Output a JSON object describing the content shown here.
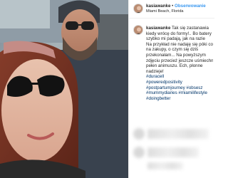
{
  "post": {
    "username": "kasiawanke",
    "separator": "•",
    "follow_label": "Obserwowanie",
    "location": "Miami Beach, Florida"
  },
  "caption": {
    "username": "kasiawanke",
    "lines": [
      " Tak się zastanawia",
      "kiedy wrócę do formy!.. Bo batery",
      "szybko mi padają, jak na razie",
      "Na przykład nie nadaję się póki co",
      "na zakupy, o czym się dziś",
      "przekonałam... Na powyższym",
      "zdjęciu przecież jeszcze uśmiechnięta",
      "pełen animuszu. Ech, płonne",
      "nadzieje!"
    ],
    "hashtag_lines": [
      "#duracell",
      "#poweredpositivity",
      "#postpartumjourney #obsesz",
      "#mummydiaries #miamilifestyle",
      "#doingbetter"
    ]
  },
  "photo": {
    "description_icon": "selfie-photo"
  },
  "icons": {
    "avatar": "user-avatar-icon"
  },
  "colors": {
    "follow": "#3897f0",
    "hashtag": "#003569",
    "text": "#262626"
  }
}
